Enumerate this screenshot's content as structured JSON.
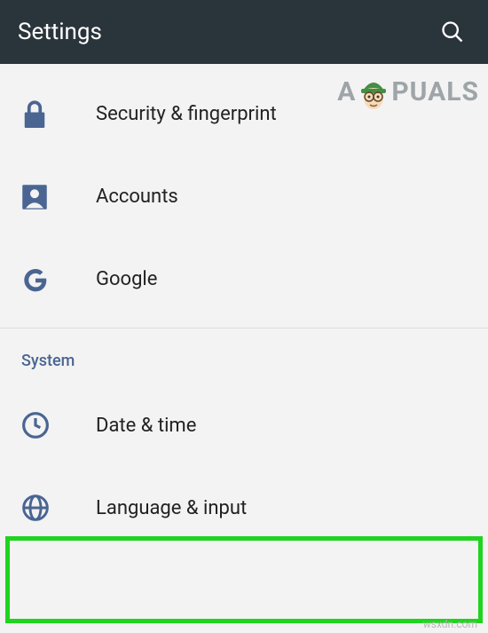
{
  "header": {
    "title": "Settings"
  },
  "items": {
    "security": {
      "label": "Security & fingerprint"
    },
    "accounts": {
      "label": "Accounts"
    },
    "google": {
      "label": "Google"
    },
    "datetime": {
      "label": "Date & time"
    },
    "language": {
      "label": "Language & input"
    }
  },
  "section": {
    "system": "System"
  },
  "watermark": {
    "left": "A",
    "right": "PUALS"
  },
  "caption": "wsxdn.com"
}
